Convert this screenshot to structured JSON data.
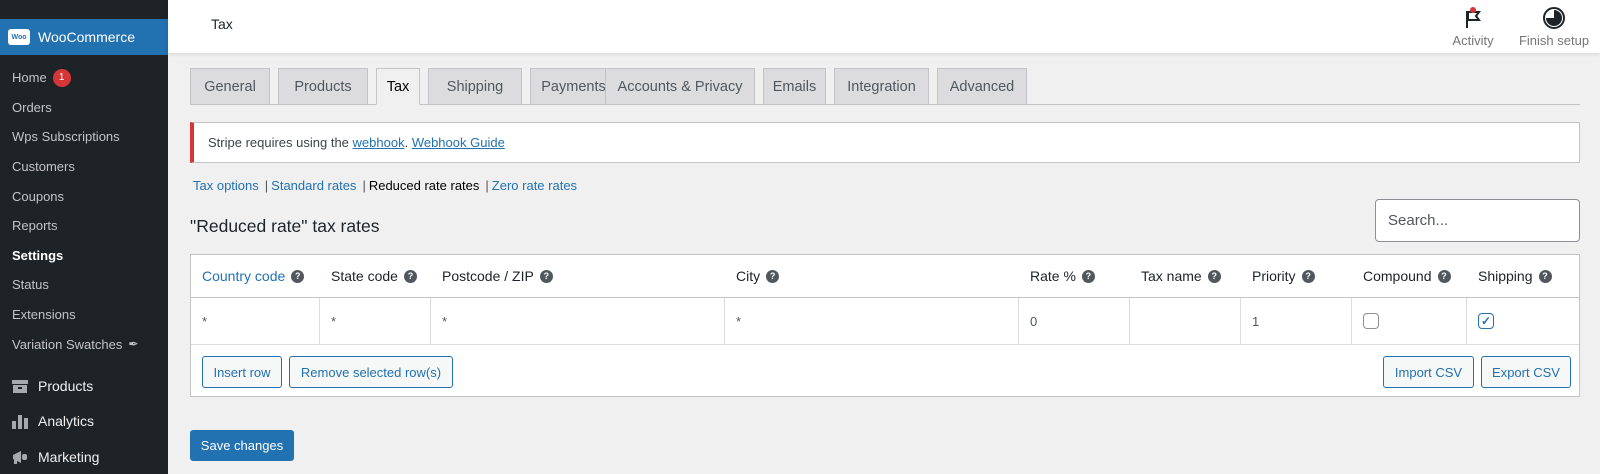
{
  "header": {
    "page_title": "Tax",
    "activity_label": "Activity",
    "finish_setup_label": "Finish setup"
  },
  "sidebar": {
    "brand": "WooCommerce",
    "logo_text": "Woo",
    "submenu": [
      {
        "label": "Home",
        "badge": "1"
      },
      {
        "label": "Orders"
      },
      {
        "label": "Wps Subscriptions"
      },
      {
        "label": "Customers"
      },
      {
        "label": "Coupons"
      },
      {
        "label": "Reports"
      },
      {
        "label": "Settings",
        "current": true
      },
      {
        "label": "Status"
      },
      {
        "label": "Extensions"
      },
      {
        "label": "Variation Swatches"
      }
    ],
    "menu": [
      {
        "label": "Products",
        "icon": "archive-icon"
      },
      {
        "label": "Analytics",
        "icon": "bar-chart-icon"
      },
      {
        "label": "Marketing",
        "icon": "megaphone-icon"
      }
    ]
  },
  "tabs": [
    "General",
    "Products",
    "Tax",
    "Shipping",
    "Payments",
    "Accounts & Privacy",
    "Emails",
    "Integration",
    "Advanced"
  ],
  "active_tab": "Tax",
  "notice": {
    "text_before": "Stripe requires using the ",
    "link1": "webhook",
    "separator": ". ",
    "link2": "Webhook Guide"
  },
  "subnav": {
    "items": [
      "Tax options",
      "Standard rates",
      "Reduced rate rates",
      "Zero rate rates"
    ],
    "separator": "|",
    "current": "Reduced rate rates"
  },
  "section_title": "\"Reduced rate\" tax rates",
  "search": {
    "placeholder": "Search...",
    "value": ""
  },
  "table": {
    "columns": [
      "Country code",
      "State code",
      "Postcode / ZIP",
      "City",
      "Rate %",
      "Tax name",
      "Priority",
      "Compound",
      "Shipping"
    ],
    "rows": [
      {
        "country": "*",
        "state": "*",
        "postcode": "*",
        "city": "*",
        "rate": "0",
        "tax_name": "",
        "priority": "1",
        "compound": false,
        "shipping": true
      }
    ]
  },
  "buttons": {
    "insert_row": "Insert row",
    "remove_rows": "Remove selected row(s)",
    "import_csv": "Import CSV",
    "export_csv": "Export CSV",
    "save": "Save changes"
  },
  "colors": {
    "accent": "#2271b1",
    "sidebar_bg": "#1d2327",
    "notice_error": "#d63638"
  }
}
